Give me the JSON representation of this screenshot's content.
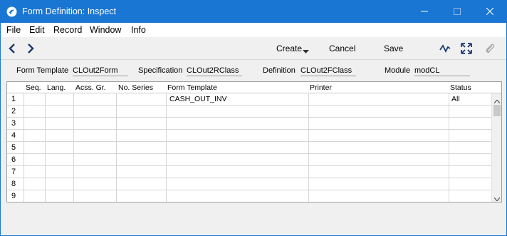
{
  "window": {
    "title": "Form Definition: Inspect"
  },
  "menu": {
    "items": [
      "File",
      "Edit",
      "Record",
      "Window",
      "Info"
    ]
  },
  "toolbar": {
    "create_label": "Create",
    "cancel_label": "Cancel",
    "save_label": "Save"
  },
  "header": {
    "form_template_label": "Form Template",
    "form_template_value": "CLOut2Form",
    "specification_label": "Specification",
    "specification_value": "CLOut2RClass",
    "definition_label": "Definition",
    "definition_value": "CLOut2FClass",
    "module_label": "Module",
    "module_value": "modCL"
  },
  "grid": {
    "columns": [
      "Seq.",
      "Lang.",
      "Acss. Gr.",
      "No. Series",
      "Form Template",
      "Printer",
      "Status"
    ],
    "rows": [
      {
        "num": "1",
        "seq": "",
        "lang": "",
        "acss": "",
        "series": "",
        "form_template": "CASH_OUT_INV",
        "printer": "",
        "status": "All"
      },
      {
        "num": "2",
        "seq": "",
        "lang": "",
        "acss": "",
        "series": "",
        "form_template": "",
        "printer": "",
        "status": ""
      },
      {
        "num": "3",
        "seq": "",
        "lang": "",
        "acss": "",
        "series": "",
        "form_template": "",
        "printer": "",
        "status": ""
      },
      {
        "num": "4",
        "seq": "",
        "lang": "",
        "acss": "",
        "series": "",
        "form_template": "",
        "printer": "",
        "status": ""
      },
      {
        "num": "5",
        "seq": "",
        "lang": "",
        "acss": "",
        "series": "",
        "form_template": "",
        "printer": "",
        "status": ""
      },
      {
        "num": "6",
        "seq": "",
        "lang": "",
        "acss": "",
        "series": "",
        "form_template": "",
        "printer": "",
        "status": ""
      },
      {
        "num": "7",
        "seq": "",
        "lang": "",
        "acss": "",
        "series": "",
        "form_template": "",
        "printer": "",
        "status": ""
      },
      {
        "num": "8",
        "seq": "",
        "lang": "",
        "acss": "",
        "series": "",
        "form_template": "",
        "printer": "",
        "status": ""
      },
      {
        "num": "9",
        "seq": "",
        "lang": "",
        "acss": "",
        "series": "",
        "form_template": "",
        "printer": "",
        "status": ""
      }
    ]
  },
  "icons": {
    "app": "app-logo-icon",
    "minimize": "minimize-icon",
    "maximize": "maximize-icon",
    "close": "close-icon",
    "prev": "arrow-left-icon",
    "next": "arrow-right-icon",
    "dropdown": "caret-down-icon",
    "activity": "activity-icon",
    "expand": "expand-icon",
    "attach": "paperclip-icon"
  },
  "colors": {
    "titlebar": "#1976d2",
    "background": "#f0f0f0"
  }
}
